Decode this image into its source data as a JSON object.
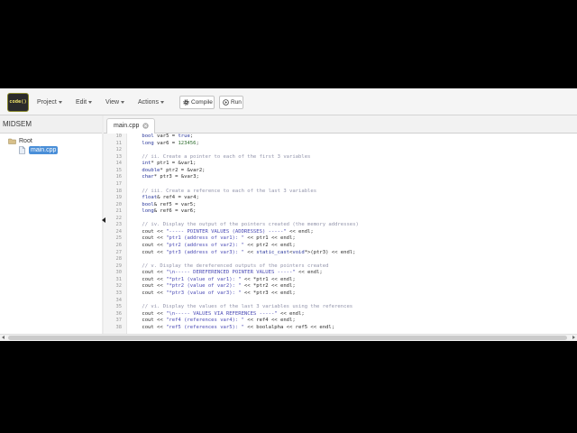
{
  "app": {
    "logo_text": "code()",
    "menus": [
      {
        "label": "Project",
        "icon": "chevron-down-icon"
      },
      {
        "label": "Edit",
        "icon": "chevron-down-icon"
      },
      {
        "label": "View",
        "icon": "chevron-down-icon"
      },
      {
        "label": "Actions",
        "icon": "chevron-down-icon"
      }
    ],
    "buttons": {
      "compile": {
        "label": "Compile",
        "icon": "gear-icon"
      },
      "run": {
        "label": "Run",
        "icon": "play-circle-icon"
      }
    }
  },
  "sidebar": {
    "title": "MIDSEM",
    "tree": {
      "root": {
        "label": "Root",
        "icon": "folder-icon"
      },
      "files": [
        {
          "label": "main.cpp",
          "icon": "file-icon",
          "selected": true
        }
      ]
    }
  },
  "editor": {
    "tabs": [
      {
        "label": "main.cpp",
        "active": true,
        "close_icon": "close-icon"
      }
    ],
    "lines": [
      {
        "n": "10",
        "code": "    bool var5 = true;"
      },
      {
        "n": "11",
        "code": "    long var6 = 123456;"
      },
      {
        "n": "12",
        "code": ""
      },
      {
        "n": "13",
        "code": "    // ii. Create a pointer to each of the first 3 variables"
      },
      {
        "n": "14",
        "code": "    int* ptr1 = &var1;"
      },
      {
        "n": "15",
        "code": "    double* ptr2 = &var2;"
      },
      {
        "n": "16",
        "code": "    char* ptr3 = &var3;"
      },
      {
        "n": "17",
        "code": ""
      },
      {
        "n": "18",
        "code": "    // iii. Create a reference to each of the last 3 variables"
      },
      {
        "n": "19",
        "code": "    float& ref4 = var4;"
      },
      {
        "n": "20",
        "code": "    bool& ref5 = var5;"
      },
      {
        "n": "21",
        "code": "    long& ref6 = var6;"
      },
      {
        "n": "22",
        "code": ""
      },
      {
        "n": "23",
        "code": "    // iv. Display the output of the pointers created (the memory addresses)"
      },
      {
        "n": "24",
        "code": "    cout << \"----- POINTER VALUES (ADDRESSES) -----\" << endl;"
      },
      {
        "n": "25",
        "code": "    cout << \"ptr1 (address of var1): \" << ptr1 << endl;"
      },
      {
        "n": "26",
        "code": "    cout << \"ptr2 (address of var2): \" << ptr2 << endl;"
      },
      {
        "n": "27",
        "code": "    cout << \"ptr3 (address of var3): \" << static_cast<void*>(ptr3) << endl;"
      },
      {
        "n": "28",
        "code": ""
      },
      {
        "n": "29",
        "code": "    // v. Display the dereferenced outputs of the pointers created"
      },
      {
        "n": "30",
        "code": "    cout << \"\\n----- DEREFERENCED POINTER VALUES -----\" << endl;"
      },
      {
        "n": "31",
        "code": "    cout << \"*ptr1 (value of var1): \" << *ptr1 << endl;"
      },
      {
        "n": "32",
        "code": "    cout << \"*ptr2 (value of var2): \" << *ptr2 << endl;"
      },
      {
        "n": "33",
        "code": "    cout << \"*ptr3 (value of var3): \" << *ptr3 << endl;"
      },
      {
        "n": "34",
        "code": ""
      },
      {
        "n": "35",
        "code": "    // vi. Display the values of the last 3 variables using the references"
      },
      {
        "n": "36",
        "code": "    cout << \"\\n----- VALUES VIA REFERENCES -----\" << endl;"
      },
      {
        "n": "37",
        "code": "    cout << \"ref4 (references var4): \" << ref4 << endl;"
      },
      {
        "n": "38",
        "code": "    cout << \"ref5 (references var5): \" << boolalpha << ref5 << endl;"
      }
    ]
  },
  "colors": {
    "comment": "#9294ab",
    "string": "#4b4bb5",
    "keyword": "#27349a",
    "number": "#2f6e2f",
    "selection": "#4a8fd8"
  }
}
